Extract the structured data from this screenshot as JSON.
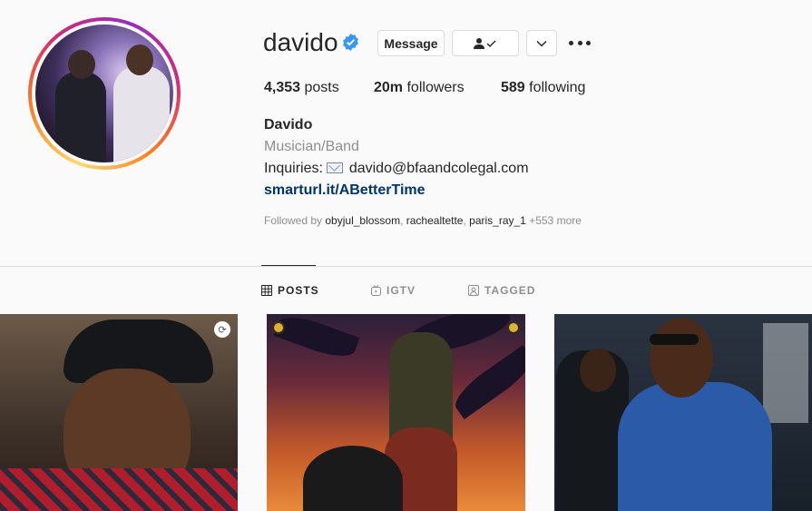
{
  "profile": {
    "username": "davido",
    "verified": true,
    "buttons": {
      "message": "Message",
      "follow_icon": "person-check-icon",
      "dropdown_icon": "chevron-down-icon",
      "more_icon": "more-options-icon"
    },
    "stats": {
      "posts_count": "4,353",
      "posts_label": "posts",
      "followers_count": "20m",
      "followers_label": "followers",
      "following_count": "589",
      "following_label": "following"
    },
    "full_name": "Davido",
    "category": "Musician/Band",
    "bio_prefix": "Inquiries:",
    "bio_email": "davido@bfaandcolegal.com",
    "link": "smarturl.it/ABetterTime",
    "followed_by": {
      "prefix": "Followed by",
      "users": [
        "obyjul_blossom",
        "rachealtette",
        "paris_ray_1"
      ],
      "more": "+553 more"
    }
  },
  "tabs": [
    {
      "label": "POSTS",
      "icon": "grid-icon",
      "active": true
    },
    {
      "label": "IGTV",
      "icon": "igtv-icon",
      "active": false
    },
    {
      "label": "TAGGED",
      "icon": "tagged-icon",
      "active": false
    }
  ],
  "colors": {
    "verified": "#3897f0",
    "link": "#003569",
    "muted": "#8e8e8e"
  }
}
